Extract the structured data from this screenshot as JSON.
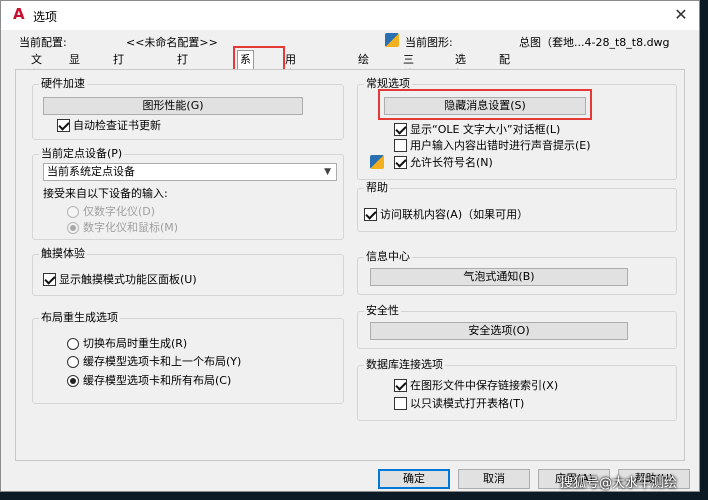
{
  "window": {
    "title": "选项",
    "close_glyph": "✕"
  },
  "profile": {
    "current_config_label": "当前配置:",
    "current_config_value": "<<未命名配置>>",
    "current_drawing_label": "当前图形:",
    "current_drawing_value": "总图（套地...4-28_t8_t8.dwg"
  },
  "tabs": [
    "文件",
    "显示",
    "打开和保存",
    "打印和发布",
    "系统",
    "用户系统配置",
    "绘图",
    "三维建模",
    "选择集",
    "配置"
  ],
  "active_tab": "系统",
  "hardware": {
    "title": "硬件加速",
    "perf_button": "图形性能(G)",
    "auto_check_label": "自动检查证书更新",
    "auto_check_checked": true
  },
  "pointing": {
    "title": "当前定点设备(P)",
    "selected": "当前系统定点设备",
    "accept_label": "接受来自以下设备的输入:",
    "radio1": "仅数字化仪(D)",
    "radio2": "数字化仪和鼠标(M)"
  },
  "touch": {
    "title": "触摸体验",
    "show_touch_label": "显示触摸模式功能区面板(U)",
    "checked": true
  },
  "layout_regen": {
    "title": "布局重生成选项",
    "opt1": "切换布局时重生成(R)",
    "opt2": "缓存模型选项卡和上一个布局(Y)",
    "opt3": "缓存模型选项卡和所有布局(C)",
    "selected": 3
  },
  "general": {
    "title": "常规选项",
    "hidden_msg_button": "隐藏消息设置(S)",
    "opt1": "显示“OLE 文字大小”对话框(L)",
    "opt2": "用户输入内容出错时进行声音提示(E)",
    "opt3": "允许长符号名(N)",
    "opt1_checked": true,
    "opt2_checked": false,
    "opt3_checked": true
  },
  "help": {
    "title": "帮助",
    "online_label": "访问联机内容(A)（如果可用）",
    "checked": true
  },
  "info_center": {
    "title": "信息中心",
    "balloon_button": "气泡式通知(B)"
  },
  "security": {
    "title": "安全性",
    "security_button": "安全选项(O)"
  },
  "dbconnect": {
    "title": "数据库连接选项",
    "opt1": "在图形文件中保存链接索引(X)",
    "opt2": "以只读模式打开表格(T)",
    "opt1_checked": true,
    "opt2_checked": false
  },
  "footer": {
    "ok": "确定",
    "cancel": "取消",
    "apply": "应用(A)",
    "help": "帮助(H)"
  },
  "watermark": "搜狐号@大水牛测绘",
  "colors": {
    "accent_red": "#e53935",
    "dialog_bg": "#f0f0f0",
    "autocad_red": "#c8102e"
  }
}
